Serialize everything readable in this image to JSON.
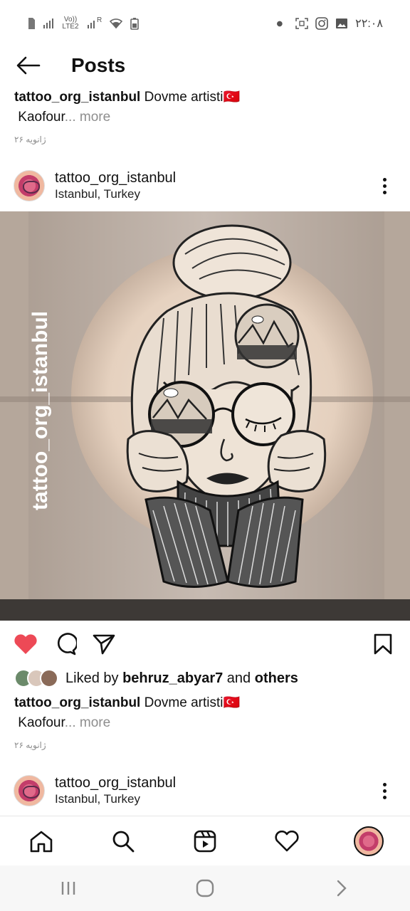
{
  "status_bar": {
    "network": "Vo)) LTE2",
    "signal_badge": "R",
    "time": "۲۲:۰۸"
  },
  "header": {
    "title": "Posts"
  },
  "top_caption": {
    "username": "tattoo_org_istanbul",
    "text": "Dovme artisti",
    "flag": "🇹🇷",
    "second_line": "Kaofour",
    "more": "... more",
    "date": "۲۶ ژانویه"
  },
  "post": {
    "username": "tattoo_org_istanbul",
    "location": "Istanbul, Turkey",
    "image_watermark": "tattoo_org_istanbul",
    "liked_by_prefix": "Liked by",
    "liked_by_user": "behruz_abyar7",
    "liked_by_join": "and",
    "liked_by_others": "others",
    "caption_username": "tattoo_org_istanbul",
    "caption_text": "Dovme artisti",
    "caption_flag": "🇹🇷",
    "caption_second_line": "Kaofour",
    "caption_more": "... more",
    "date": "۲۶ ژانویه",
    "liked": true,
    "like_color": "#ed4956"
  },
  "next_post": {
    "username": "tattoo_org_istanbul",
    "location": "Istanbul, Turkey"
  },
  "bottom_nav": {
    "items": [
      "home-icon",
      "search-icon",
      "reels-icon",
      "activity-heart-icon",
      "profile-avatar"
    ]
  },
  "system_nav": {
    "items": [
      "recent-apps",
      "home",
      "back"
    ]
  }
}
